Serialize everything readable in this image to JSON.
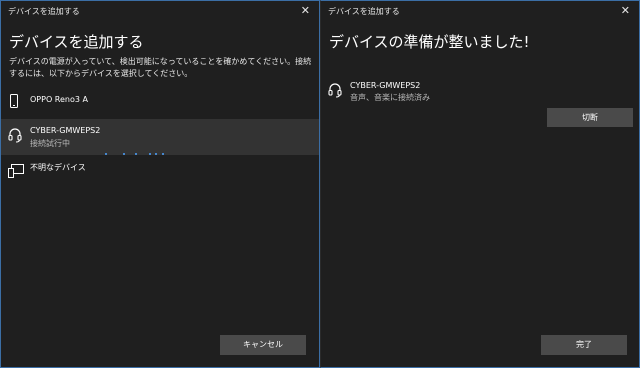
{
  "left_window": {
    "title": "デバイスを追加する",
    "heading": "デバイスを追加する",
    "description": "デバイスの電源が入っていて、検出可能になっていることを確かめてください。接続するには、以下からデバイスを選択してください。",
    "devices": [
      {
        "name": "OPPO Reno3 A",
        "status": "",
        "icon": "phone-icon"
      },
      {
        "name": "CYBER-GMWEPS2",
        "status": "接続試行中",
        "icon": "headset-icon"
      },
      {
        "name": "不明なデバイス",
        "status": "",
        "icon": "unknown-device-icon"
      }
    ],
    "cancel_label": "キャンセル"
  },
  "right_window": {
    "title": "デバイスを追加する",
    "heading": "デバイスの準備が整いました!",
    "device": {
      "name": "CYBER-GMWEPS2",
      "status": "音声、音楽に接続済み",
      "icon": "headset-icon"
    },
    "disconnect_label": "切断",
    "done_label": "完了"
  },
  "colors": {
    "window_bg": "#1f1f1f",
    "selected_bg": "#333333",
    "button_bg": "#4a4a4a",
    "progress_dots": "#4da3ff",
    "border": "#3b6ea5"
  }
}
